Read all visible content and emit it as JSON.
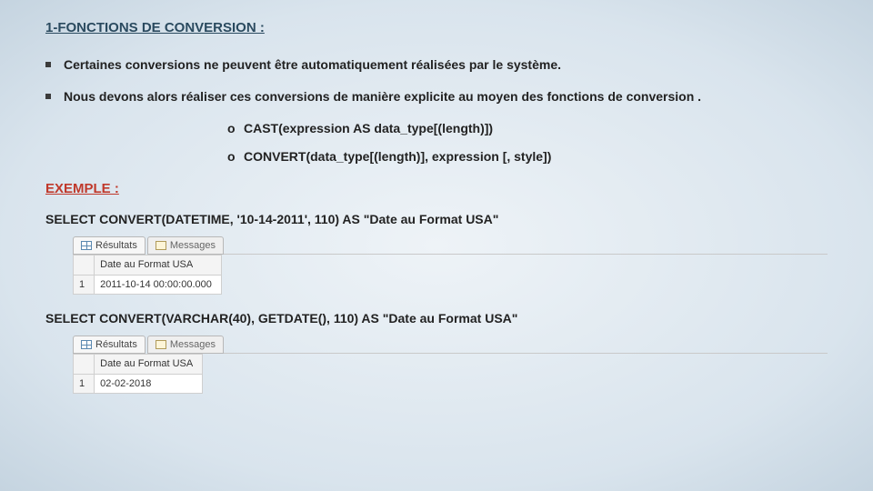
{
  "heading": "1-FONCTIONS DE CONVERSION :",
  "bullets": [
    "Certaines conversions ne peuvent être automatiquement réalisées par le système.",
    "Nous devons alors réaliser ces conversions de manière explicite au moyen des fonctions de conversion ."
  ],
  "sub_items": [
    {
      "mark": "o",
      "text": "CAST(expression AS data_type[(length)])"
    },
    {
      "mark": "o",
      "text": "CONVERT(data_type[(length)], expression [, style])"
    }
  ],
  "exemple_label": "EXEMPLE :",
  "example1": {
    "sql": "SELECT CONVERT(DATETIME, '10-14-2011', 110) AS \"Date au Format USA\"",
    "tabs": {
      "results": "Résultats",
      "messages": "Messages"
    },
    "col_header": "Date au Format USA",
    "row_num": "1",
    "value": "2011-10-14 00:00:00.000"
  },
  "example2": {
    "sql": "SELECT CONVERT(VARCHAR(40), GETDATE(), 110) AS \"Date au Format USA\"",
    "tabs": {
      "results": "Résultats",
      "messages": "Messages"
    },
    "col_header": "Date au Format USA",
    "row_num": "1",
    "value": "02-02-2018"
  }
}
